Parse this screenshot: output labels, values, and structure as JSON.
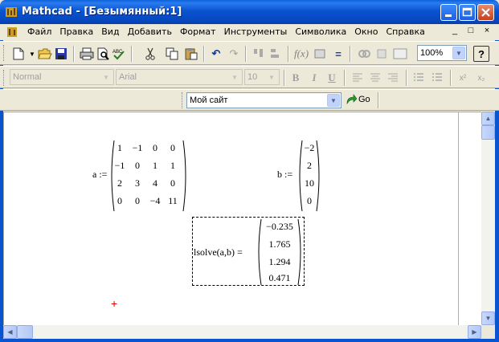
{
  "window": {
    "title": "Mathcad - [Безымянный:1]"
  },
  "menu": [
    "Файл",
    "Правка",
    "Вид",
    "Добавить",
    "Формат",
    "Инструменты",
    "Символика",
    "Окно",
    "Справка"
  ],
  "mdi_controls": [
    "_",
    "□",
    "×"
  ],
  "toolbar": {
    "zoom": "100%",
    "help_label": "?"
  },
  "format_bar": {
    "style": "Normal",
    "font": "Arial",
    "size": "10",
    "bold": "B",
    "italic": "I",
    "underline": "U"
  },
  "resource_bar": {
    "site": "Мой сайт",
    "go_label": "Go"
  },
  "worksheet": {
    "a_label": "a :=",
    "a_matrix": [
      [
        "1",
        "−1",
        "0",
        "0"
      ],
      [
        "−1",
        "0",
        "1",
        "1"
      ],
      [
        "2",
        "3",
        "4",
        "0"
      ],
      [
        "0",
        "0",
        "−4",
        "11"
      ]
    ],
    "b_label": "b :=",
    "b_vector": [
      "−2",
      "2",
      "10",
      "0"
    ],
    "lsolve_label": "lsolve(a,b) =",
    "result_vector": [
      "−0.235",
      "1.765",
      "1.294",
      "0.471"
    ],
    "cursor": "+"
  },
  "colors": {
    "title_blue": "#0a54d0",
    "cursor_red": "#e00000"
  }
}
